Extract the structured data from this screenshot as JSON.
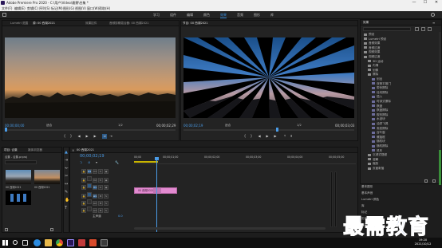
{
  "window": {
    "title": "Adobe Premiere Pro 2020 - C:\\用户\\Video\\最需\\合集 *",
    "minimize": "—",
    "maximize": "☐",
    "close": "✕"
  },
  "menu": [
    "文件(F)",
    "编辑(E)",
    "剪辑(C)",
    "序列(S)",
    "标记(M)",
    "图形(G)",
    "视图(V)",
    "窗口(W)",
    "帮助(H)"
  ],
  "workspaces": [
    "学习",
    "组件",
    "编辑",
    "颜色",
    "效果",
    "音频",
    "图形",
    "库"
  ],
  "active_workspace": "效果",
  "source_monitor": {
    "tabs": [
      "Lumetri 范围",
      "源: 00 西湖2021",
      "效果控件",
      "音频剪辑混合器: 00 西湖2021"
    ],
    "timecode_in": "00;00;00;00",
    "fit": "适合",
    "page": "1/2",
    "timecode_out": "00;00;02;29"
  },
  "program_monitor": {
    "tab": "节目: 00 西湖2021",
    "timecode_in": "00;00;02;19",
    "fit": "适合",
    "page": "1/2",
    "timecode_out": "00;00;03;03"
  },
  "project": {
    "tabs": [
      "项目: 合集",
      "媒体浏览器"
    ],
    "search_placeholder": "",
    "path": "合集 - 合集.prproj",
    "items": [
      "00 西湖2021",
      "00 西湖2021"
    ]
  },
  "timeline": {
    "tab": "00 西湖2021",
    "timecode": "00;00;02;19",
    "ruler": [
      "00;00",
      "00;00;01;00",
      "00;00;02;00",
      "00;00;03;00",
      "00;00;04;00",
      "00;00;05;00"
    ],
    "video_tracks": [
      "V3",
      "V2",
      "V1"
    ],
    "audio_tracks": [
      "A1",
      "A2",
      "A3"
    ],
    "master_label": "主声道",
    "master_value": "0.0",
    "clip_label": "00 西湖2021"
  },
  "effects_panel": {
    "tab": "效果",
    "search_placeholder": "",
    "items": [
      {
        "label": "预设",
        "level": 0,
        "folder": true
      },
      {
        "label": "Lumetri 预设",
        "level": 0,
        "folder": true
      },
      {
        "label": "音频效果",
        "level": 0,
        "folder": true
      },
      {
        "label": "音频过渡",
        "level": 0,
        "folder": true
      },
      {
        "label": "视频效果",
        "level": 0,
        "folder": true
      },
      {
        "label": "视频过渡",
        "level": 0,
        "folder": true
      },
      {
        "label": "3D 运动",
        "level": 1,
        "folder": true
      },
      {
        "label": "内滑",
        "level": 1,
        "folder": true
      },
      {
        "label": "划像",
        "level": 1,
        "folder": true
      },
      {
        "label": "擦除",
        "level": 1,
        "folder": true
      },
      {
        "label": "划出",
        "level": 2,
        "folder": false
      },
      {
        "label": "双侧平推门",
        "level": 2,
        "folder": false
      },
      {
        "label": "带状擦除",
        "level": 2,
        "folder": false
      },
      {
        "label": "径向擦除",
        "level": 2,
        "folder": false
      },
      {
        "label": "插入",
        "level": 2,
        "folder": false
      },
      {
        "label": "时钟式擦除",
        "level": 2,
        "folder": false
      },
      {
        "label": "棋盘",
        "level": 2,
        "folder": false
      },
      {
        "label": "棋盘擦除",
        "level": 2,
        "folder": false
      },
      {
        "label": "楔形擦除",
        "level": 2,
        "folder": false
      },
      {
        "label": "水波块",
        "level": 2,
        "folder": false
      },
      {
        "label": "油漆飞溅",
        "level": 2,
        "folder": false
      },
      {
        "label": "渐变擦除",
        "level": 2,
        "folder": false
      },
      {
        "label": "百叶窗",
        "level": 2,
        "folder": false
      },
      {
        "label": "螺旋框",
        "level": 2,
        "folder": false
      },
      {
        "label": "随机块",
        "level": 2,
        "folder": false
      },
      {
        "label": "随机擦除",
        "level": 2,
        "folder": false
      },
      {
        "label": "风车",
        "level": 2,
        "folder": false
      },
      {
        "label": "沉浸式视频",
        "level": 1,
        "folder": true
      },
      {
        "label": "溶解",
        "level": 1,
        "folder": true
      },
      {
        "label": "缩放",
        "level": 1,
        "folder": true
      },
      {
        "label": "页面剥落",
        "level": 1,
        "folder": true
      }
    ],
    "bottom_panels": [
      "基本图形",
      "基本声音",
      "Lumetri 颜色",
      "库",
      "标记",
      "历史记录",
      "信息"
    ]
  },
  "taskbar": {
    "time": "19:20",
    "date": "2021/10/12"
  },
  "watermark": "最需教育",
  "colors": {
    "accent": "#3a8fe0",
    "clip": "#e28ad0",
    "playhead": "#4a9be6",
    "watermark": "#1b57b8"
  }
}
